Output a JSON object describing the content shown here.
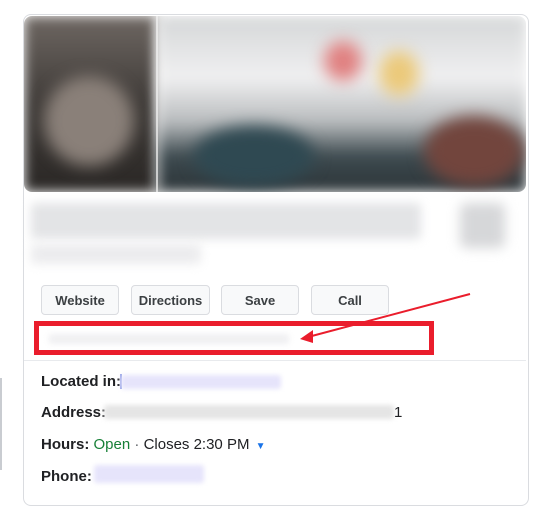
{
  "actions": {
    "website": "Website",
    "directions": "Directions",
    "save": "Save",
    "call": "Call"
  },
  "details": {
    "located_label": "Located in:",
    "address_label": "Address:",
    "address_tail": "1",
    "hours_label": "Hours:",
    "hours_status": "Open",
    "hours_separator": "·",
    "hours_closes": "Closes 2:30 PM",
    "phone_label": "Phone:"
  },
  "icons": {
    "hours_dropdown": "caret-down-icon"
  },
  "colors": {
    "annotation": "#ea1d2c",
    "open_status": "#188038",
    "dropdown_accent": "#1a73e8"
  }
}
